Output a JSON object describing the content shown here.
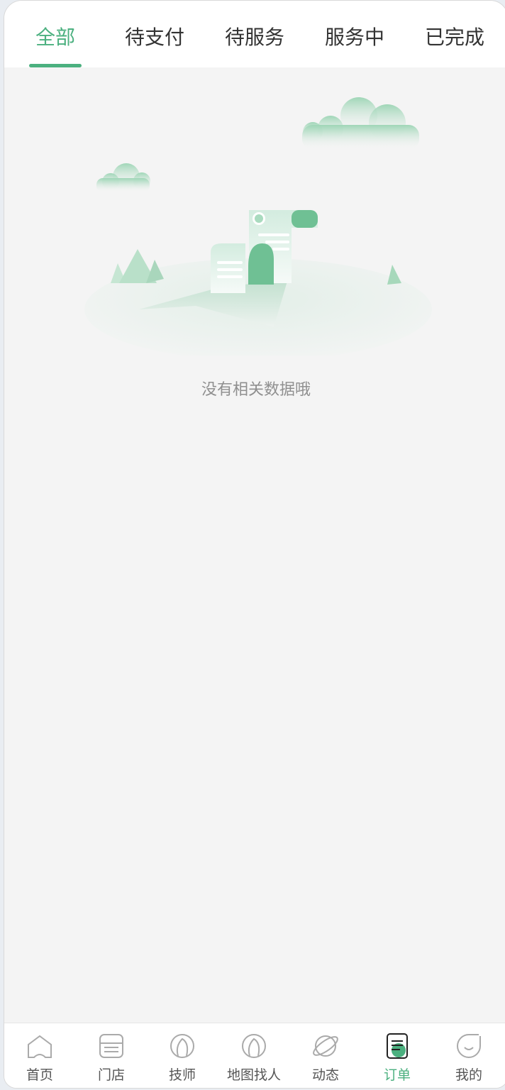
{
  "tabs": [
    {
      "label": "全部",
      "active": true
    },
    {
      "label": "待支付",
      "active": false
    },
    {
      "label": "待服务",
      "active": false
    },
    {
      "label": "服务中",
      "active": false
    },
    {
      "label": "已完成",
      "active": false
    }
  ],
  "empty_state": {
    "message": "没有相关数据哦",
    "illustration": "empty-document-landscape"
  },
  "bottom_nav": [
    {
      "label": "首页",
      "icon": "home-icon",
      "active": false
    },
    {
      "label": "门店",
      "icon": "store-icon",
      "active": false
    },
    {
      "label": "技师",
      "icon": "technician-icon",
      "active": false
    },
    {
      "label": "地图找人",
      "icon": "map-person-icon",
      "active": false
    },
    {
      "label": "动态",
      "icon": "planet-icon",
      "active": false
    },
    {
      "label": "订单",
      "icon": "order-icon",
      "active": true
    },
    {
      "label": "我的",
      "icon": "profile-icon",
      "active": false
    }
  ],
  "colors": {
    "accent": "#4bb07f",
    "text_primary": "#333333",
    "text_muted": "#8f8f8f",
    "background": "#f4f4f4"
  }
}
